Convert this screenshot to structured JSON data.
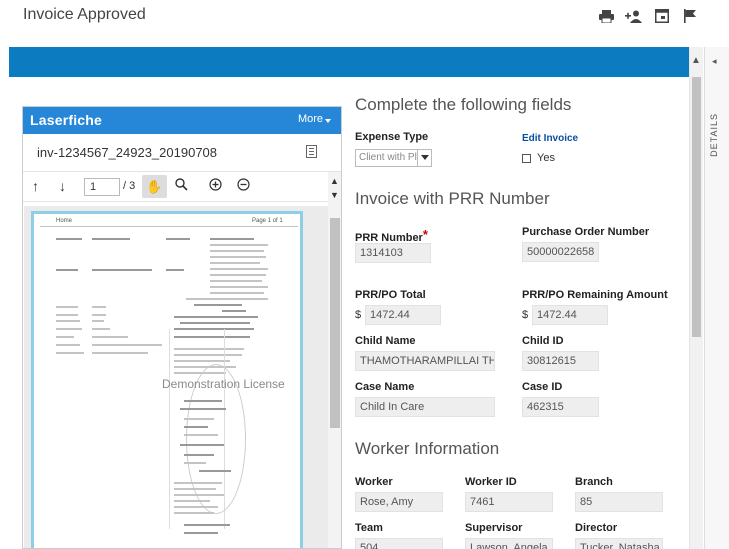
{
  "window": {
    "title": "Invoice Approved",
    "icons": [
      "print-icon",
      "assign-user-icon",
      "window-icon",
      "flag-icon"
    ]
  },
  "details_tab": {
    "label": "DETAILS"
  },
  "viewer": {
    "brand": "Laserfiche",
    "more_label": "More",
    "file_name": "inv-1234567_24923_20190708",
    "page_current": "1",
    "page_total": "/ 3",
    "watermark": "Demonstration License",
    "page_header_left": "Home",
    "page_header_right": "Page 1 of 1"
  },
  "form": {
    "section1": "Complete the following fields",
    "expense_type_label": "Expense Type",
    "expense_type_value": "Client with Pl",
    "edit_invoice_label": "Edit Invoice",
    "edit_invoice_option": "Yes",
    "section2": "Invoice with PRR Number",
    "prr_number_label": "PRR Number",
    "prr_number_value": "1314103",
    "po_number_label": "Purchase Order Number",
    "po_number_value": "50000022658",
    "prr_total_label": "PRR/PO Total",
    "prr_total_currency": "$",
    "prr_total_value": "1472.44",
    "prr_remaining_label": "PRR/PO Remaining Amount",
    "prr_remaining_currency": "$",
    "prr_remaining_value": "1472.44",
    "child_name_label": "Child Name",
    "child_name_value": "THAMOTHARAMPILLAI THIF",
    "child_id_label": "Child ID",
    "child_id_value": "30812615",
    "case_name_label": "Case Name",
    "case_name_value": "Child In Care",
    "case_id_label": "Case ID",
    "case_id_value": "462315",
    "section3": "Worker Information",
    "worker_label": "Worker",
    "worker_value": "Rose, Amy",
    "worker_id_label": "Worker ID",
    "worker_id_value": "7461",
    "branch_label": "Branch",
    "branch_value": "85",
    "team_label": "Team",
    "team_value": "504",
    "supervisor_label": "Supervisor",
    "supervisor_value": "Lawson, Angela",
    "director_label": "Director",
    "director_value": "Tucker, Natasha"
  },
  "colors": {
    "accent_bar": "#0c7bc0",
    "viewer_header": "#2687d8",
    "required": "#cc0000",
    "link": "#0a4fa3"
  }
}
